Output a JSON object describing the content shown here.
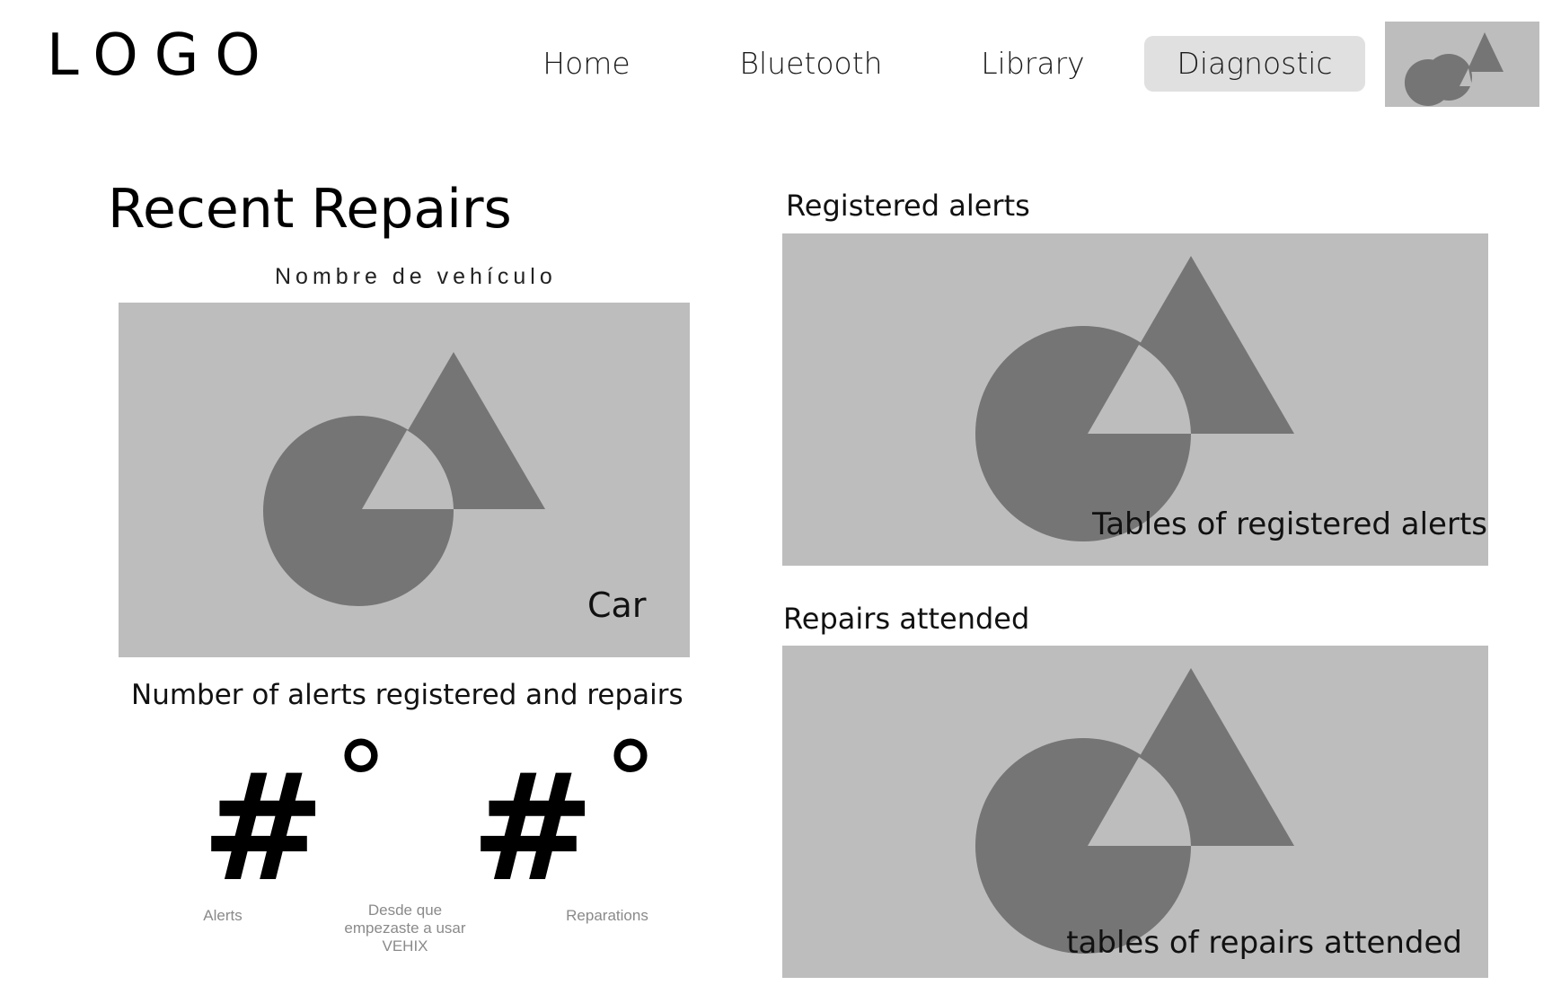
{
  "header": {
    "logo": "LOGO",
    "nav": [
      {
        "label": "Home"
      },
      {
        "label": "Bluetooth"
      },
      {
        "label": "Library"
      },
      {
        "label": "Diagnostic",
        "active": true
      }
    ],
    "avatar_icon": "image-placeholder-icon"
  },
  "left": {
    "title": "Recent Repairs",
    "vehicle_name": "Nombre de vehículo",
    "car_image_label": "Car",
    "counts_title": "Number of alerts registered and repairs",
    "alerts_count": "#",
    "repairs_count": "#",
    "degree_mark": "°",
    "alerts_caption": "Alerts",
    "since_caption": "Desde que empezaste a usar VEHIX",
    "repairs_caption": "Reparations"
  },
  "right": {
    "alerts_title": "Registered alerts",
    "alerts_table_label": "Tables of registered alerts",
    "repairs_title": "Repairs attended",
    "repairs_table_label": "tables of repairs attended"
  },
  "colors": {
    "placeholder_bg": "#bdbdbd",
    "placeholder_shape": "#757575",
    "active_nav_bg": "#e0e0e0",
    "caption_gray": "#8a8a8a"
  }
}
